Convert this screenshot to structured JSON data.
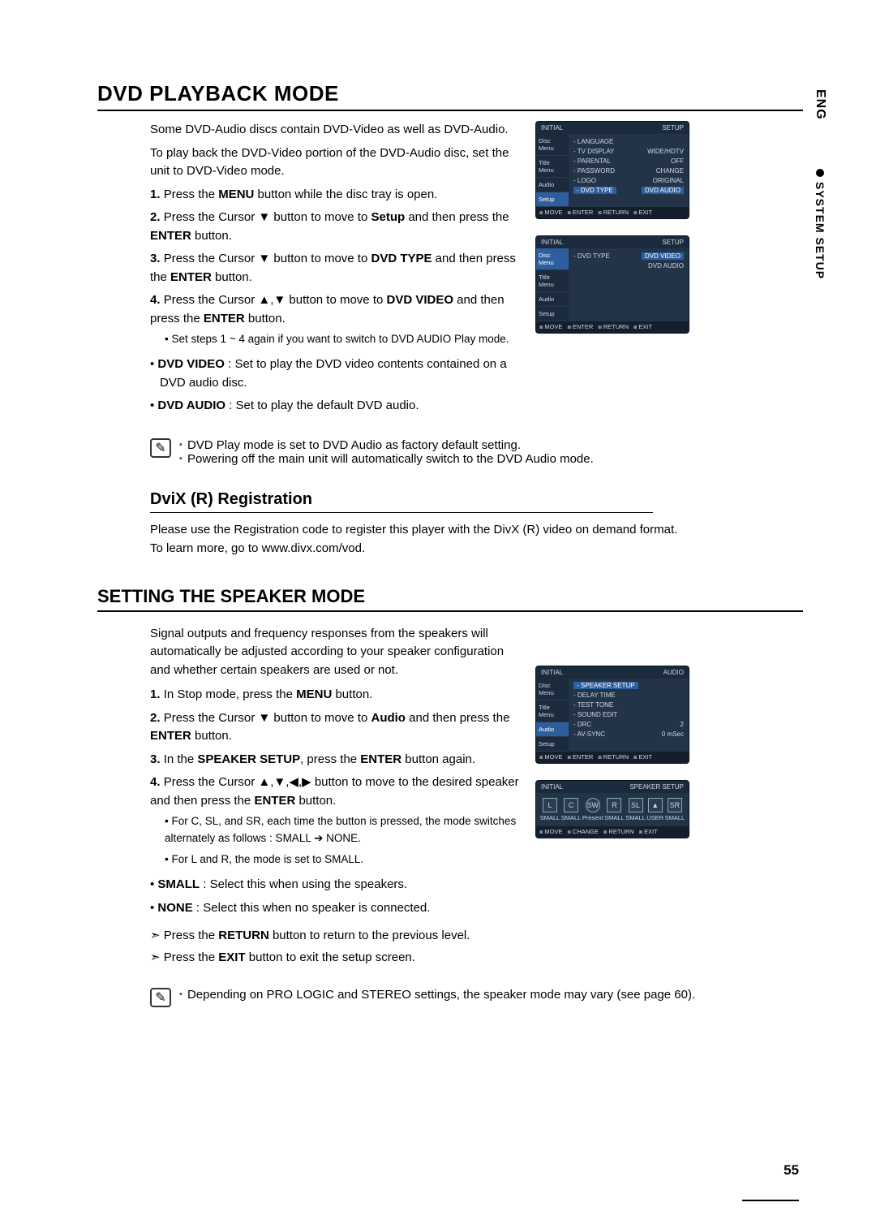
{
  "sideTab": {
    "lang": "ENG",
    "section": "SYSTEM SETUP"
  },
  "pageNumber": "55",
  "s1": {
    "title": "DVD PLAYBACK MODE",
    "p1": "Some DVD-Audio discs contain DVD-Video as well as DVD-Audio.",
    "p2": "To play back the DVD-Video portion of the DVD-Audio disc, set the unit to DVD-Video mode.",
    "step1": {
      "n": "1.",
      "a": "Press the ",
      "b": "MENU",
      "c": " button while the disc tray is open."
    },
    "step2": {
      "n": "2.",
      "a": "Press the Cursor ▼ button to move to ",
      "b": "Setup",
      "c": " and then press the ",
      "d": "ENTER",
      "e": " button."
    },
    "step3": {
      "n": "3.",
      "a": "Press the Cursor ▼ button to move to ",
      "b": "DVD TYPE",
      "c": " and then press the ",
      "d": "ENTER",
      "e": " button."
    },
    "step4": {
      "n": "4.",
      "a": "Press the Cursor ▲,▼ button to move to ",
      "b": "DVD VIDEO",
      "c": " and then press the ",
      "d": "ENTER",
      "e": " button."
    },
    "sub1": "Set steps 1 ~ 4 again if you want to switch to DVD AUDIO Play mode.",
    "def1": {
      "term": "DVD VIDEO",
      "text": " : Set to play the DVD video contents contained on a DVD audio disc."
    },
    "def2": {
      "term": "DVD AUDIO",
      "text": " : Set to play the default DVD audio."
    },
    "note1": "DVD Play mode is set to DVD Audio as factory default setting.",
    "note2": "Powering off the main unit will automatically switch to the DVD Audio mode."
  },
  "s2": {
    "title": "DviX (R) Registration",
    "p1": "Please use the Registration code to register this player with the DivX (R) video on demand format.",
    "p2": "To learn more, go to www.divx.com/vod."
  },
  "s3": {
    "title": "SETTING THE SPEAKER MODE",
    "p1": "Signal outputs and frequency responses from the speakers will automatically be adjusted according to your speaker configuration and whether certain speakers are used or not.",
    "step1": {
      "n": "1.",
      "a": "In Stop mode, press the ",
      "b": "MENU",
      "c": " button."
    },
    "step2": {
      "n": "2.",
      "a": "Press the Cursor ▼ button to move to ",
      "b": "Audio",
      "c": " and then press the ",
      "d": "ENTER",
      "e": " button."
    },
    "step3": {
      "n": "3.",
      "a": "In the ",
      "b": "SPEAKER SETUP",
      "c": ", press the ",
      "d": "ENTER",
      "e": " button again."
    },
    "step4": {
      "n": "4.",
      "a": "Press the Cursor ▲,▼,◀,▶ button to move to the desired speaker and then press the ",
      "b": "ENTER",
      "c": " button."
    },
    "sub1": "For C, SL, and SR, each time the button is pressed, the mode switches alternately as follows : SMALL ➔ NONE.",
    "sub2": "For L and R, the mode is set to SMALL.",
    "def1": {
      "term": "SMALL",
      "text": " : Select this when using the speakers."
    },
    "def2": {
      "term": "NONE",
      "text": " : Select this when no speaker is connected."
    },
    "ret": {
      "a": "Press the ",
      "b": "RETURN",
      "c": " button to return to the previous level."
    },
    "exit": {
      "a": "Press the ",
      "b": "EXIT",
      "c": " button to exit the setup screen."
    },
    "note1": "Depending on PRO LOGIC and STEREO settings, the speaker mode may vary (see page 60)."
  },
  "osd": {
    "brand": "INITIAL",
    "setup": "SETUP",
    "audio": "AUDIO",
    "spk": "SPEAKER SETUP",
    "side": {
      "disc": "Disc Menu",
      "title": "Title Menu",
      "aud": "Audio",
      "set": "Setup"
    },
    "rows1": {
      "language": {
        "lbl": "LANGUAGE",
        "val": ""
      },
      "tv": {
        "lbl": "TV DISPLAY",
        "val": "WIDE/HDTV"
      },
      "parental": {
        "lbl": "PARENTAL",
        "val": "OFF"
      },
      "password": {
        "lbl": "PASSWORD",
        "val": "CHANGE"
      },
      "logo": {
        "lbl": "LOGO",
        "val": "ORIGINAL"
      },
      "dvdtype": {
        "lbl": "DVD TYPE",
        "val": "DVD AUDIO"
      }
    },
    "rows2": {
      "dvdtype": {
        "lbl": "DVD TYPE",
        "opt1": "DVD VIDEO",
        "opt2": "DVD AUDIO"
      }
    },
    "rows3": {
      "spsetup": {
        "lbl": "SPEAKER SETUP",
        "val": ""
      },
      "delay": {
        "lbl": "DELAY TIME",
        "val": ""
      },
      "tone": {
        "lbl": "TEST TONE",
        "val": ""
      },
      "sedit": {
        "lbl": "SOUND EDIT",
        "val": ""
      },
      "drc": {
        "lbl": "DRC",
        "val": "2"
      },
      "avsync": {
        "lbl": "AV-SYNC",
        "val": "0 mSec"
      }
    },
    "spkLabels": {
      "small": "SMALL",
      "present": "Present",
      "user": "USER"
    },
    "spkIcons": {
      "l": "L",
      "c": "C",
      "sw": "SW",
      "r": "R",
      "sl": "SL",
      "sr": "SR"
    },
    "foot": {
      "move": "MOVE",
      "enter": "ENTER",
      "change": "CHANGE",
      "ret": "RETURN",
      "exit": "EXIT"
    }
  }
}
